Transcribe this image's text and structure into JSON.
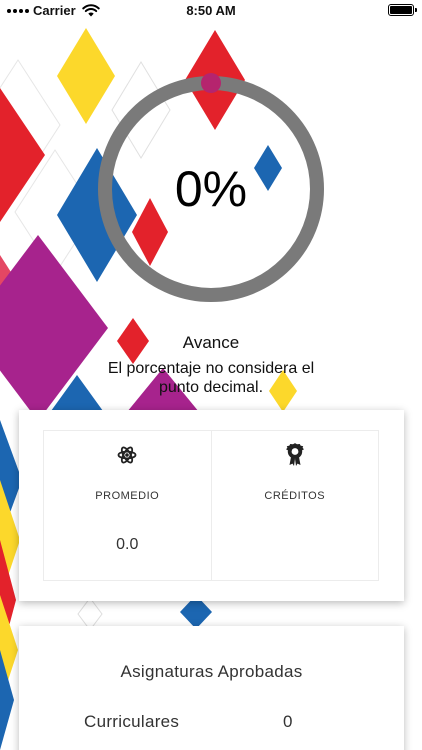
{
  "status_bar": {
    "carrier": "Carrier",
    "time": "8:50 AM"
  },
  "progress": {
    "display": "0%",
    "value": 0,
    "track_color": "#7a7a7a",
    "knob_color": "#b5246e"
  },
  "advance": {
    "title": "Avance",
    "note": "El porcentaje no considera el punto decimal."
  },
  "stats": {
    "average": {
      "icon": "atom-icon",
      "label": "PROMEDIO",
      "value": "0.0"
    },
    "credits": {
      "icon": "award-ribbon-icon",
      "label": "CRÉDITOS",
      "value": ""
    }
  },
  "subjects": {
    "title": "Asignaturas Aprobadas",
    "rows": [
      {
        "label": "Curriculares",
        "value": "0"
      }
    ]
  },
  "colors": {
    "red": "#e3222b",
    "yellow": "#fcd82b",
    "blue": "#1c66b1",
    "magenta": "#a7238d",
    "pink": "#e44763"
  }
}
